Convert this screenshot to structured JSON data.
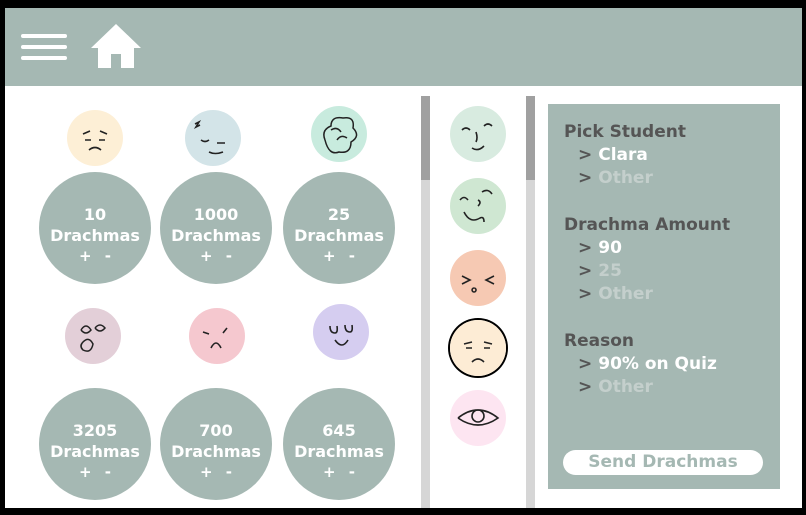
{
  "header": {
    "menu_icon": "hamburger-menu-icon",
    "home_icon": "home-icon"
  },
  "students": [
    {
      "face_color": "#fdefd6",
      "amount": "10",
      "unit": "Drachmas",
      "plus": "+",
      "minus": "-"
    },
    {
      "face_color": "#d3e4e8",
      "amount": "1000",
      "unit": "Drachmas",
      "plus": "+",
      "minus": "-"
    },
    {
      "face_color": "#c8ebde",
      "amount": "25",
      "unit": "Drachmas",
      "plus": "+",
      "minus": "-"
    },
    {
      "face_color": "#e3cfd8",
      "amount": "3205",
      "unit": "Drachmas",
      "plus": "+",
      "minus": "-"
    },
    {
      "face_color": "#f5c8cf",
      "amount": "700",
      "unit": "Drachmas",
      "plus": "+",
      "minus": "-"
    },
    {
      "face_color": "#d5cdf0",
      "amount": "645",
      "unit": "Drachmas",
      "plus": "+",
      "minus": "-"
    }
  ],
  "side_faces": [
    {
      "color": "#d8ebe0"
    },
    {
      "color": "#cfe7d2"
    },
    {
      "color": "#f6c9b3"
    },
    {
      "color": "#fdecd5"
    },
    {
      "color": "#fde5f1"
    }
  ],
  "panel": {
    "pick_student": {
      "title": "Pick Student",
      "options": [
        {
          "label": "Clara",
          "state": "selected"
        },
        {
          "label": "Other",
          "state": "dim"
        }
      ]
    },
    "amount": {
      "title": "Drachma Amount",
      "options": [
        {
          "label": "90",
          "state": "selected"
        },
        {
          "label": "25",
          "state": "dim"
        },
        {
          "label": "Other",
          "state": "dim"
        }
      ]
    },
    "reason": {
      "title": "Reason",
      "options": [
        {
          "label": "90% on Quiz",
          "state": "selected"
        },
        {
          "label": "Other",
          "state": "dim"
        }
      ]
    },
    "arrow": ">",
    "send_label": "Send Drachmas"
  },
  "colors": {
    "accent": "#a5b8b3",
    "topbar": "#a5b8b3",
    "white": "#ffffff",
    "dark_text": "#555555"
  }
}
